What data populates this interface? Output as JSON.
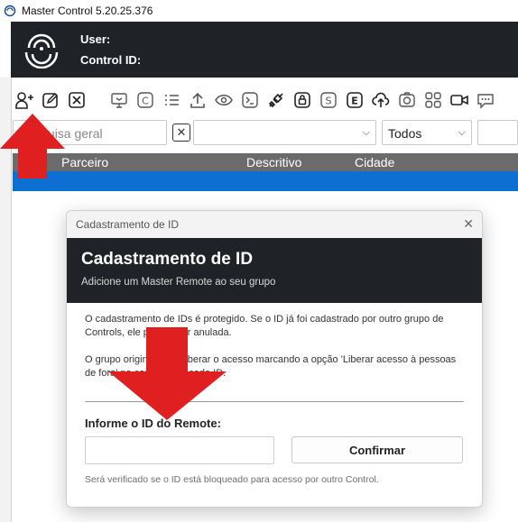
{
  "window": {
    "title": "Master Control 5.20.25.376"
  },
  "header": {
    "user_label": "User:",
    "control_id_label": "Control ID:"
  },
  "toolbar": {
    "icons": [
      "add-user-icon",
      "edit-icon",
      "delete-icon",
      "monitor-icon",
      "c-icon",
      "list-icon",
      "upload-icon",
      "eye-icon",
      "terminal-icon",
      "plug-icon",
      "lock-icon",
      "s-icon",
      "e-icon",
      "cloud-upload-icon",
      "camera-icon",
      "grid-icon",
      "video-icon",
      "chat-icon"
    ]
  },
  "filters": {
    "search_placeholder": "Pesquisa geral",
    "clear_symbol": "✕",
    "select1_value": "",
    "select2_value": "Todos",
    "select3_value": ""
  },
  "grid": {
    "columns": [
      "Parceiro",
      "Descritivo",
      "Cidade"
    ]
  },
  "dialog": {
    "window_title": "Cadastramento de ID",
    "heading": "Cadastramento de ID",
    "subtitle": "Adicione um Master Remote ao seu grupo",
    "paragraph1": "O cadastramento de IDs é protegido. Se o ID já foi cadastrado por outro grupo de Controls, ele poderá ser anulada.",
    "paragraph2": "O grupo original pode liberar o acesso marcando a opção 'Liberar acesso à pessoas de fora' no cadastro de cada ID.",
    "id_label": "Informe o ID do Remote:",
    "id_value": "",
    "confirm_label": "Confirmar",
    "verify_note": "Será verificado se o ID está bloqueado para acesso por outro Control."
  },
  "colors": {
    "header_bg": "#1f2327",
    "selected_row": "#0d6fd1",
    "grid_header_bg": "#6b6b6b",
    "arrow_red": "#e02020"
  }
}
